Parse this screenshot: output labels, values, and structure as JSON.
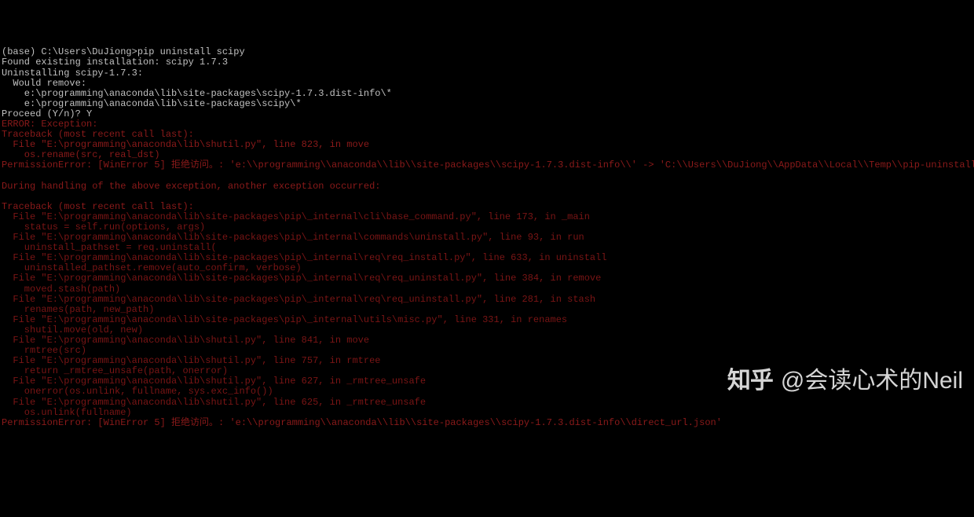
{
  "terminal": {
    "lines": [
      {
        "cls": "normal",
        "text": "(base) C:\\Users\\DuJiong>pip uninstall scipy"
      },
      {
        "cls": "normal",
        "text": "Found existing installation: scipy 1.7.3"
      },
      {
        "cls": "normal",
        "text": "Uninstalling scipy-1.7.3:"
      },
      {
        "cls": "normal",
        "text": "  Would remove:"
      },
      {
        "cls": "normal",
        "text": "    e:\\programming\\anaconda\\lib\\site-packages\\scipy-1.7.3.dist-info\\*"
      },
      {
        "cls": "normal",
        "text": "    e:\\programming\\anaconda\\lib\\site-packages\\scipy\\*"
      },
      {
        "cls": "normal",
        "text": "Proceed (Y/n)? Y"
      },
      {
        "cls": "error",
        "text": "ERROR: Exception:"
      },
      {
        "cls": "error",
        "text": "Traceback (most recent call last):"
      },
      {
        "cls": "error",
        "text": "  File \"E:\\programming\\anaconda\\lib\\shutil.py\", line 823, in move"
      },
      {
        "cls": "error",
        "text": "    os.rename(src, real_dst)"
      },
      {
        "cls": "error",
        "text": "PermissionError: [WinError 5] 拒绝访问。: 'e:\\\\programming\\\\anaconda\\\\lib\\\\site-packages\\\\scipy-1.7.3.dist-info\\\\' -> 'C:\\\\Users\\\\DuJiong\\\\AppData\\\\Local\\\\Temp\\\\pip-uninstall-liwywrux'"
      },
      {
        "cls": "error",
        "text": ""
      },
      {
        "cls": "error",
        "text": "During handling of the above exception, another exception occurred:"
      },
      {
        "cls": "error",
        "text": ""
      },
      {
        "cls": "error",
        "text": "Traceback (most recent call last):"
      },
      {
        "cls": "error2",
        "text": "  File \"E:\\programming\\anaconda\\lib\\site-packages\\pip\\_internal\\cli\\base_command.py\", line 173, in _main"
      },
      {
        "cls": "error2",
        "text": "    status = self.run(options, args)"
      },
      {
        "cls": "error2",
        "text": "  File \"E:\\programming\\anaconda\\lib\\site-packages\\pip\\_internal\\commands\\uninstall.py\", line 93, in run"
      },
      {
        "cls": "error2",
        "text": "    uninstall_pathset = req.uninstall("
      },
      {
        "cls": "error2",
        "text": "  File \"E:\\programming\\anaconda\\lib\\site-packages\\pip\\_internal\\req\\req_install.py\", line 633, in uninstall"
      },
      {
        "cls": "error2",
        "text": "    uninstalled_pathset.remove(auto_confirm, verbose)"
      },
      {
        "cls": "error2",
        "text": "  File \"E:\\programming\\anaconda\\lib\\site-packages\\pip\\_internal\\req\\req_uninstall.py\", line 384, in remove"
      },
      {
        "cls": "error2",
        "text": "    moved.stash(path)"
      },
      {
        "cls": "error2",
        "text": "  File \"E:\\programming\\anaconda\\lib\\site-packages\\pip\\_internal\\req\\req_uninstall.py\", line 281, in stash"
      },
      {
        "cls": "error2",
        "text": "    renames(path, new_path)"
      },
      {
        "cls": "error2",
        "text": "  File \"E:\\programming\\anaconda\\lib\\site-packages\\pip\\_internal\\utils\\misc.py\", line 331, in renames"
      },
      {
        "cls": "error2",
        "text": "    shutil.move(old, new)"
      },
      {
        "cls": "error2",
        "text": "  File \"E:\\programming\\anaconda\\lib\\shutil.py\", line 841, in move"
      },
      {
        "cls": "error2",
        "text": "    rmtree(src)"
      },
      {
        "cls": "error2",
        "text": "  File \"E:\\programming\\anaconda\\lib\\shutil.py\", line 757, in rmtree"
      },
      {
        "cls": "error2",
        "text": "    return _rmtree_unsafe(path, onerror)"
      },
      {
        "cls": "error2",
        "text": "  File \"E:\\programming\\anaconda\\lib\\shutil.py\", line 627, in _rmtree_unsafe"
      },
      {
        "cls": "error2",
        "text": "    onerror(os.unlink, fullname, sys.exc_info())"
      },
      {
        "cls": "error2",
        "text": "  File \"E:\\programming\\anaconda\\lib\\shutil.py\", line 625, in _rmtree_unsafe"
      },
      {
        "cls": "error2",
        "text": "    os.unlink(fullname)"
      },
      {
        "cls": "error",
        "text": "PermissionError: [WinError 5] 拒绝访问。: 'e:\\\\programming\\\\anaconda\\\\lib\\\\site-packages\\\\scipy-1.7.3.dist-info\\\\direct_url.json'"
      },
      {
        "cls": "normal",
        "text": ""
      }
    ]
  },
  "watermark": {
    "logo": "知乎",
    "handle": "@会读心术的Neil"
  }
}
